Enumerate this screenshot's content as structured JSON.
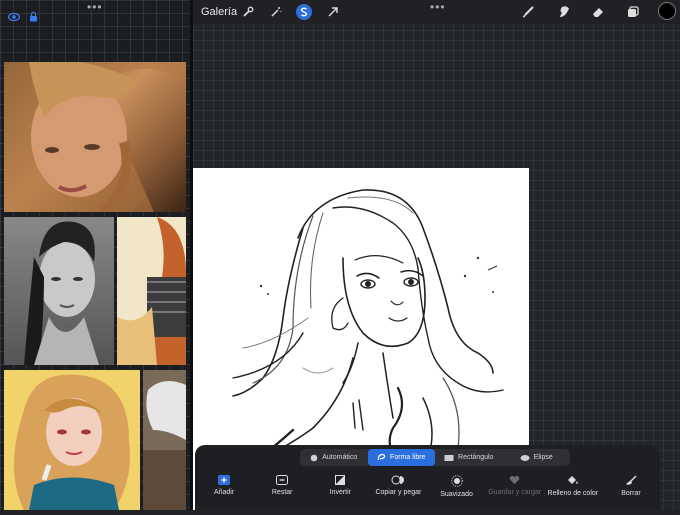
{
  "left_panel": {
    "icons": [
      "eye-icon",
      "lock-icon"
    ],
    "photos": [
      "portrait-woman-looking-up",
      "portrait-woman-grayscale",
      "illustration-redhead",
      "illustration-blonde-girl",
      "illustration-white-hair"
    ]
  },
  "topbar": {
    "gallery": "Galería",
    "icons": [
      "wrench-icon",
      "magic-wand-icon",
      "selection-s-icon",
      "arrow-transform-icon",
      "brush-icon",
      "smudge-icon",
      "eraser-icon",
      "layers-icon",
      "color-swatch-icon"
    ],
    "active_color": "#000000",
    "accent": "#2b6fde"
  },
  "selection_modes": {
    "items": [
      {
        "label": "Automático",
        "icon": "circle-icon"
      },
      {
        "label": "Forma libre",
        "icon": "lasso-icon"
      },
      {
        "label": "Rectángulo",
        "icon": "rectangle-icon"
      },
      {
        "label": "Elipse",
        "icon": "ellipse-icon"
      }
    ],
    "active": "Forma libre"
  },
  "selection_tools": {
    "items": [
      {
        "label": "Añadir",
        "icon": "add-icon"
      },
      {
        "label": "Restar",
        "icon": "subtract-icon"
      },
      {
        "label": "Invertir",
        "icon": "invert-icon"
      },
      {
        "label": "Copiar y pegar",
        "icon": "copy-paste-icon"
      },
      {
        "label": "Suavizado",
        "icon": "feather-icon"
      },
      {
        "label": "Guardar y cargar",
        "icon": "heart-icon"
      },
      {
        "label": "Relleno de color",
        "icon": "fill-icon"
      },
      {
        "label": "Borrar",
        "icon": "clear-icon"
      }
    ]
  }
}
